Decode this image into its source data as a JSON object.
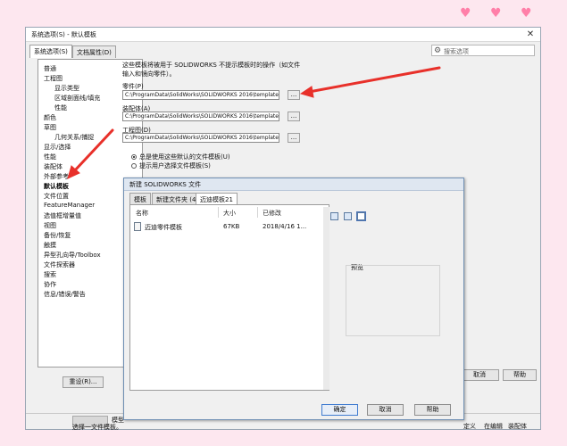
{
  "decor": {
    "hearts": [
      "♥",
      "♥",
      "♥"
    ],
    "heart_color": "#ff7fa8"
  },
  "app": {
    "title": "系统选项(S) - 默认模板",
    "close_glyph": "✕",
    "tabs": [
      "系统选项(S)",
      "文档属性(D)"
    ],
    "search_icon": "gear-icon",
    "search_placeholder": "搜索选项",
    "tree": [
      "普通",
      "工程图",
      "显示类型",
      "区域剖面线/填充",
      "性能",
      "颜色",
      "草图",
      "几何关系/捕捉",
      "显示/选择",
      "性能",
      "装配体",
      "外部参考",
      "默认模板",
      "文件位置",
      "FeatureManager",
      "选值框增量值",
      "视图",
      "备份/恢复",
      "触摸",
      "异型孔向导/Toolbox",
      "文件探索器",
      "搜索",
      "协作",
      "信息/错误/警告"
    ],
    "reset_label": "重设(R)...",
    "description": "这些模板将被用于 SOLIDWORKS 不提示模板时的操作（如文件输入和镜向零件）。",
    "part_label": "零件(P)",
    "part_path": "C:\\ProgramData\\SolidWorks\\SOLIDWORKS 2016\\templates\\零件",
    "assembly_label": "装配体(A)",
    "assembly_path": "C:\\ProgramData\\SolidWorks\\SOLIDWORKS 2016\\templates\\gb_a",
    "drawing_label": "工程图(D)",
    "drawing_path": "C:\\ProgramData\\SolidWorks\\SOLIDWORKS 2016\\templates\\工程",
    "browse_label": "...",
    "radio_default": "总是使用这些默认的文件模板(U)",
    "radio_prompt": "提示用户选择文件模板(S)",
    "cancel_label": "取消",
    "help_label": "帮助",
    "status_left_1": "模型",
    "status_left_2": "选择一文件模板。",
    "status_right_1": "定义",
    "status_right_2": "在编辑",
    "status_right_3": "装配体"
  },
  "dialog": {
    "title": "新建 SOLIDWORKS 文件",
    "tabs": [
      "模板",
      "新建文件夹 (4)",
      "迈迪模板21"
    ],
    "columns": {
      "name": "名称",
      "size": "大小",
      "modified": "已修改"
    },
    "file": {
      "name": "迈迪零件模板",
      "size": "67KB",
      "modified": "2018/4/16 1..."
    },
    "preview_label": "预览",
    "ok_label": "确定",
    "cancel_label": "取消",
    "help_label": "帮助"
  },
  "annotation_color": "#e8302a"
}
